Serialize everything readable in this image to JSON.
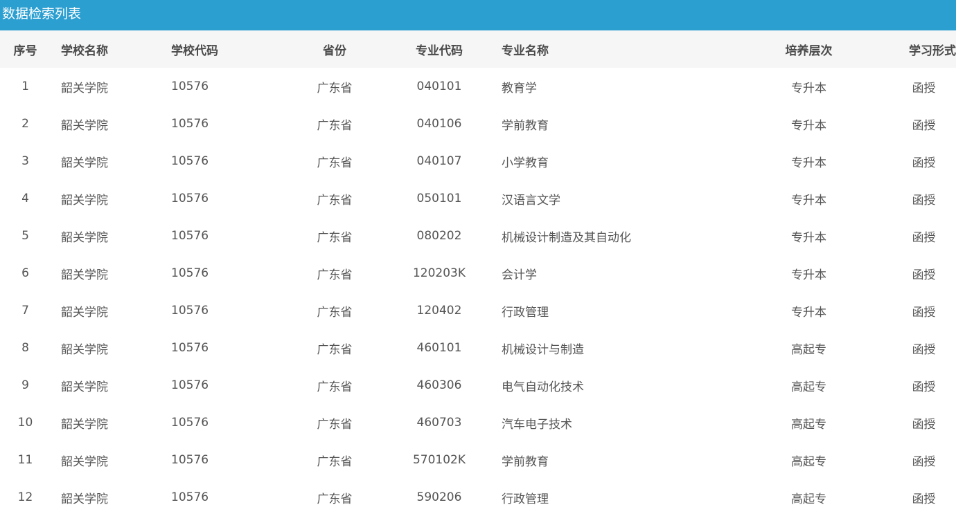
{
  "page": {
    "title": "数据检索列表"
  },
  "table": {
    "headers": {
      "index": "序号",
      "school_name": "学校名称",
      "school_code": "学校代码",
      "province": "省份",
      "major_code": "专业代码",
      "major_name": "专业名称",
      "level": "培养层次",
      "study_form": "学习形式"
    },
    "rows": [
      {
        "index": "1",
        "school_name": "韶关学院",
        "school_code": "10576",
        "province": "广东省",
        "major_code": "040101",
        "major_name": "教育学",
        "level": "专升本",
        "study_form": "函授"
      },
      {
        "index": "2",
        "school_name": "韶关学院",
        "school_code": "10576",
        "province": "广东省",
        "major_code": "040106",
        "major_name": "学前教育",
        "level": "专升本",
        "study_form": "函授"
      },
      {
        "index": "3",
        "school_name": "韶关学院",
        "school_code": "10576",
        "province": "广东省",
        "major_code": "040107",
        "major_name": "小学教育",
        "level": "专升本",
        "study_form": "函授"
      },
      {
        "index": "4",
        "school_name": "韶关学院",
        "school_code": "10576",
        "province": "广东省",
        "major_code": "050101",
        "major_name": "汉语言文学",
        "level": "专升本",
        "study_form": "函授"
      },
      {
        "index": "5",
        "school_name": "韶关学院",
        "school_code": "10576",
        "province": "广东省",
        "major_code": "080202",
        "major_name": "机械设计制造及其自动化",
        "level": "专升本",
        "study_form": "函授"
      },
      {
        "index": "6",
        "school_name": "韶关学院",
        "school_code": "10576",
        "province": "广东省",
        "major_code": "120203K",
        "major_name": "会计学",
        "level": "专升本",
        "study_form": "函授"
      },
      {
        "index": "7",
        "school_name": "韶关学院",
        "school_code": "10576",
        "province": "广东省",
        "major_code": "120402",
        "major_name": "行政管理",
        "level": "专升本",
        "study_form": "函授"
      },
      {
        "index": "8",
        "school_name": "韶关学院",
        "school_code": "10576",
        "province": "广东省",
        "major_code": "460101",
        "major_name": "机械设计与制造",
        "level": "高起专",
        "study_form": "函授"
      },
      {
        "index": "9",
        "school_name": "韶关学院",
        "school_code": "10576",
        "province": "广东省",
        "major_code": "460306",
        "major_name": "电气自动化技术",
        "level": "高起专",
        "study_form": "函授"
      },
      {
        "index": "10",
        "school_name": "韶关学院",
        "school_code": "10576",
        "province": "广东省",
        "major_code": "460703",
        "major_name": "汽车电子技术",
        "level": "高起专",
        "study_form": "函授"
      },
      {
        "index": "11",
        "school_name": "韶关学院",
        "school_code": "10576",
        "province": "广东省",
        "major_code": "570102K",
        "major_name": "学前教育",
        "level": "高起专",
        "study_form": "函授"
      },
      {
        "index": "12",
        "school_name": "韶关学院",
        "school_code": "10576",
        "province": "广东省",
        "major_code": "590206",
        "major_name": "行政管理",
        "level": "高起专",
        "study_form": "函授"
      }
    ]
  }
}
